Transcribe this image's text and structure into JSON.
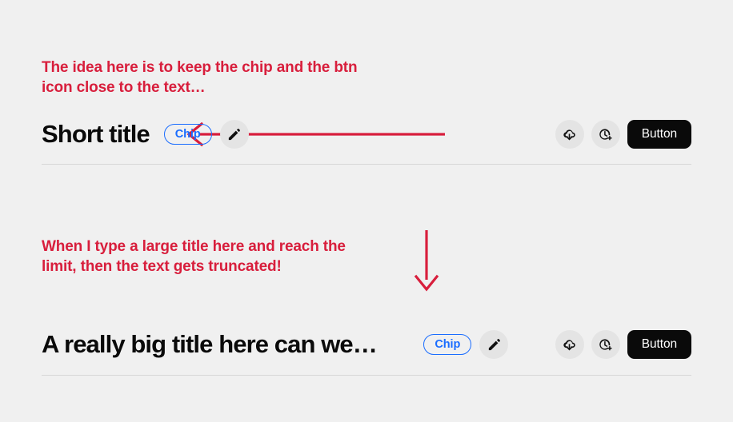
{
  "theme": {
    "background": "#f0f0f0",
    "annotation_color": "#d81e3c",
    "chip_color": "#1a6dff",
    "button_bg": "#0a0a0a",
    "button_text": "#ffffff",
    "icon_button_bg": "#e4e4e4",
    "divider_color": "#d7d7d7",
    "title_color": "#0a0a0a"
  },
  "annotations": {
    "top": "The idea here is to keep the chip and the btn\nicon close to the text…",
    "bottom": "When I type a large title here and reach the\nlimit, then the text gets truncated!"
  },
  "rows": [
    {
      "title": "Short title",
      "chip_label": "Chip",
      "edit_icon": "pencil-icon",
      "action_icons": [
        "cloud-download-icon",
        "clock-plus-icon"
      ],
      "button_label": "Button"
    },
    {
      "title": "A really big title here can we…",
      "chip_label": "Chip",
      "edit_icon": "pencil-icon",
      "action_icons": [
        "cloud-download-icon",
        "clock-plus-icon"
      ],
      "button_label": "Button"
    }
  ],
  "arrows": {
    "horizontal": "arrow-left-pointing",
    "vertical": "arrow-down-pointing"
  }
}
